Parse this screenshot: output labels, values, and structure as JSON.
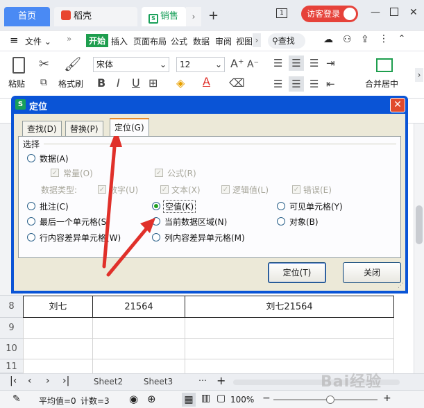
{
  "tabs": {
    "home": "首页",
    "daoke": "稻壳",
    "doc": "销售"
  },
  "login": "访客登录",
  "menu": {
    "file": "文件",
    "start": "开始",
    "insert": "插入",
    "page_layout": "页面布局",
    "formula": "公式",
    "data": "数据",
    "review": "审阅",
    "view": "视图",
    "search": "查找"
  },
  "ribbon": {
    "paste": "粘贴",
    "format_painter": "格式刷",
    "font_name": "宋体",
    "font_size": "12",
    "merge_center": "合并居中",
    "bold": "B",
    "italic": "I",
    "underline": "U"
  },
  "dialog": {
    "title": "定位",
    "tabs": [
      "查找(D)",
      "替换(P)",
      "定位(G)"
    ],
    "group_label": "选择",
    "options": {
      "data": "数据(A)",
      "constant": "常量(O)",
      "formula": "公式(R)",
      "data_type_label": "数据类型:",
      "number": "数字(U)",
      "text": "文本(X)",
      "logical": "逻辑值(L)",
      "error": "错误(E)",
      "comment": "批注(C)",
      "blank": "空值(K)",
      "visible": "可见单元格(Y)",
      "last_cell": "最后一个单元格(S)",
      "current_region": "当前数据区域(N)",
      "object": "对象(B)",
      "row_diff": "行内容差异单元格(W)",
      "col_diff": "列内容差异单元格(M)"
    },
    "selected_option": "blank",
    "buttons": {
      "locate": "定位(T)",
      "close": "关闭"
    }
  },
  "grid": {
    "rows": [
      {
        "num": "8",
        "cells": [
          "刘七",
          "21564",
          "刘七21564"
        ]
      },
      {
        "num": "9",
        "cells": [
          "",
          "",
          ""
        ]
      },
      {
        "num": "10",
        "cells": [
          "",
          "",
          ""
        ]
      },
      {
        "num": "11",
        "cells": [
          "",
          "",
          ""
        ]
      }
    ]
  },
  "sheets": [
    "Sheet2",
    "Sheet3"
  ],
  "status": {
    "average": "平均值=0",
    "count": "计数=3",
    "zoom": "100%"
  },
  "watermark": "Bai经验",
  "colors": {
    "accent_blue": "#4a8af4",
    "green_start": "#1e9e4e",
    "login_red": "#e6423a",
    "dialog_blue": "#0a54d6",
    "arrow_red": "#e0302a"
  }
}
